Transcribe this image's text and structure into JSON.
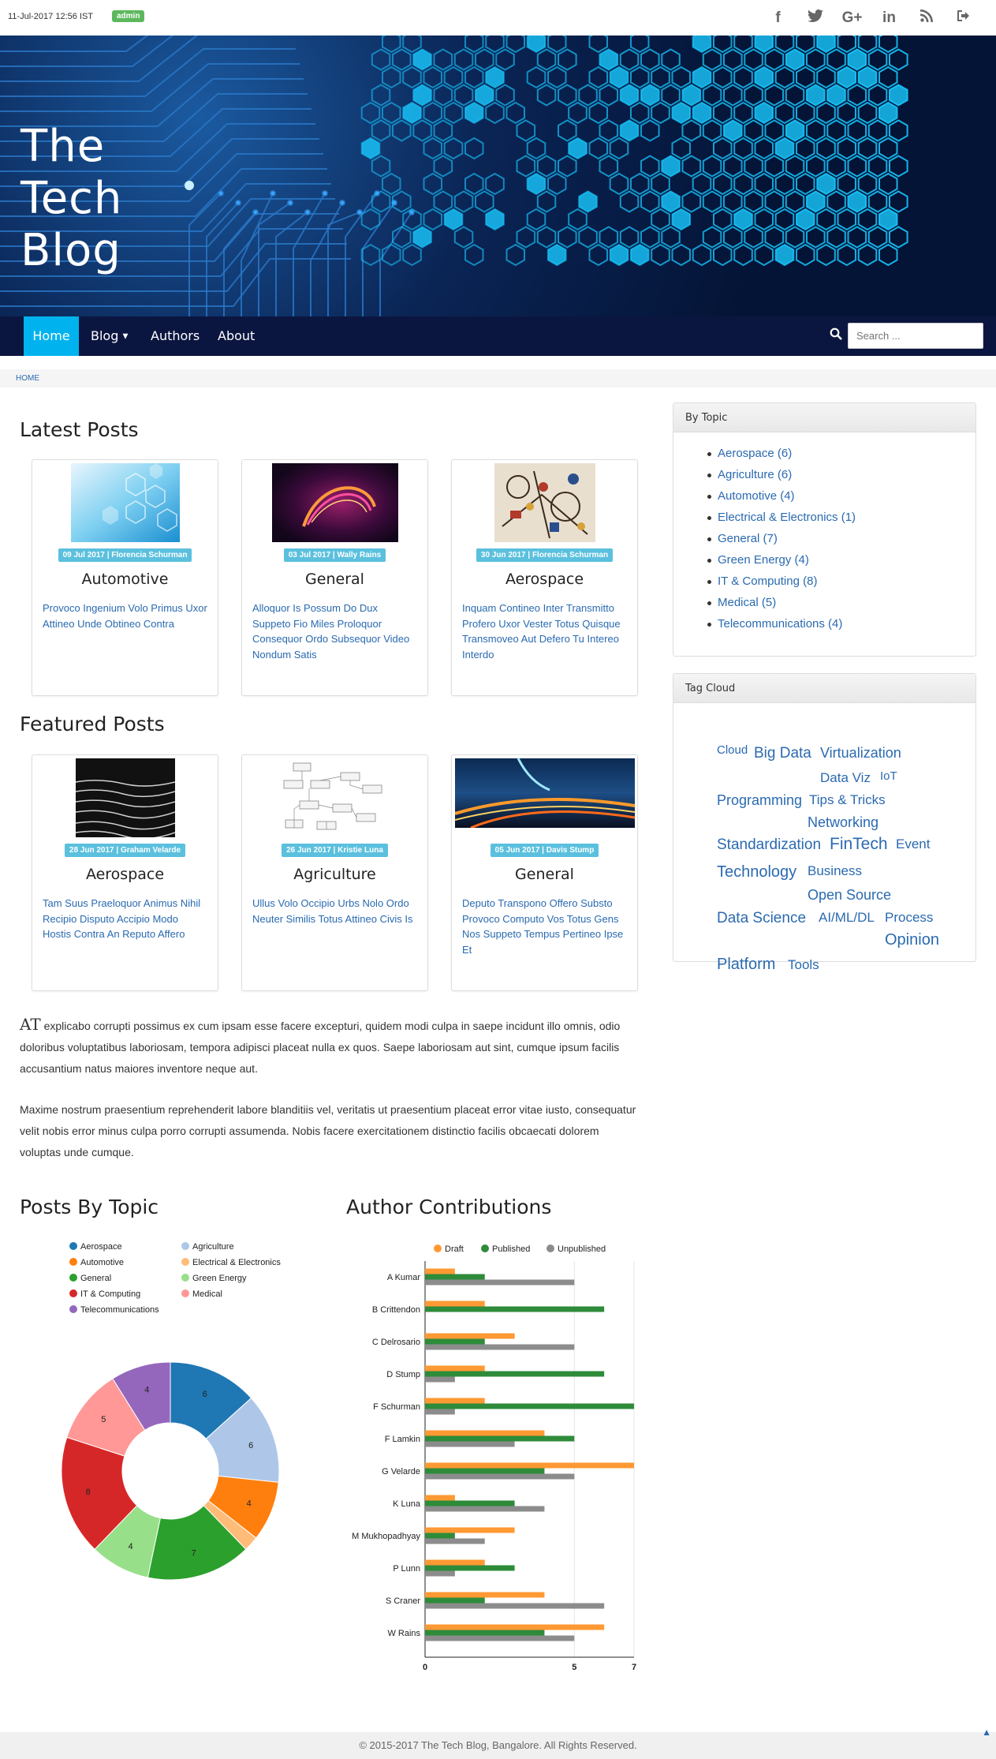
{
  "topbar": {
    "datetime": "11-Jul-2017 12:56 IST",
    "user_badge": "admin",
    "social_icons": [
      "facebook-icon",
      "twitter-icon",
      "google-plus-icon",
      "linkedin-icon",
      "rss-icon",
      "sign-out-icon"
    ]
  },
  "hero": {
    "title_lines": [
      "The",
      "Tech",
      "Blog"
    ]
  },
  "nav": {
    "items": [
      "Home",
      "Blog",
      "Authors",
      "About"
    ],
    "search_placeholder": "Search ..."
  },
  "breadcrumb": "HOME",
  "latest": {
    "heading": "Latest Posts",
    "posts": [
      {
        "meta": "09 Jul 2017 | Florencia Schurman",
        "category": "Automotive",
        "title": "Provoco Ingenium Volo Primus Uxor Attineo Unde Obtineo Contra"
      },
      {
        "meta": "03 Jul 2017 | Wally Rains",
        "category": "General",
        "title": "Alloquor Is Possum Do Dux Suppeto Fio Miles Proloquor Consequor Ordo Subsequor Video Nondum Satis"
      },
      {
        "meta": "30 Jun 2017 | Florencia Schurman",
        "category": "Aerospace",
        "title": "Inquam Contineo Inter Transmitto Profero Uxor Vester Totus Quisque Transmoveo Aut Defero Tu Intereo Interdo"
      }
    ]
  },
  "featured": {
    "heading": "Featured Posts",
    "posts": [
      {
        "meta": "28 Jun 2017 | Graham Velarde",
        "category": "Aerospace",
        "title": "Tam Suus Praeloquor Animus Nihil Recipio Disputo Accipio Modo Hostis Contra An Reputo Affero"
      },
      {
        "meta": "26 Jun 2017 | Kristie Luna",
        "category": "Agriculture",
        "title": "Ullus Volo Occipio Urbs Nolo Ordo Neuter Similis Totus Attineo Civis Is"
      },
      {
        "meta": "05 Jun 2017 | Davis Stump",
        "category": "General",
        "title": "Deputo Transpono Offero Substo Provoco Computo Vos Totus Gens Nos Suppeto Tempus Pertineo Ipse Et"
      }
    ]
  },
  "body": {
    "dropcap": "AT",
    "para1": "explicabo corrupti possimus ex cum ipsam esse facere excepturi, quidem modi culpa in saepe incidunt illo omnis, odio doloribus voluptatibus laboriosam, tempora adipisci placeat nulla ex quos. Saepe laboriosam aut sint, cumque ipsum facilis accusantium natus maiores inventore neque aut.",
    "para2": "Maxime nostrum praesentium reprehenderit labore blanditiis vel, veritatis ut praesentium placeat error vitae iusto, consequatur velit nobis error minus culpa porro corrupti assumenda. Nobis facere exercitationem distinctio facilis obcaecati dolorem voluptas unde cumque."
  },
  "sidebar": {
    "topics_heading": "By Topic",
    "topics": [
      "Aerospace (6)",
      "Agriculture (6)",
      "Automotive (4)",
      "Electrical & Electronics (1)",
      "General (7)",
      "Green Energy (4)",
      "IT & Computing (8)",
      "Medical (5)",
      "Telecommunications (4)"
    ],
    "tags_heading": "Tag Cloud",
    "tags": [
      "Cloud",
      "Big Data",
      "Virtualization",
      "Data Viz",
      "IoT",
      "Programming",
      "Tips & Tricks",
      "Networking",
      "Standardization",
      "FinTech",
      "Event",
      "Technology",
      "Business",
      "Open Source",
      "Data Science",
      "AI/ML/DL",
      "Process",
      "Opinion",
      "Platform",
      "Tools"
    ]
  },
  "charts": {
    "topic_heading": "Posts By Topic",
    "author_heading": "Author Contributions"
  },
  "chart_data": [
    {
      "type": "pie",
      "categories": [
        "Aerospace",
        "Agriculture",
        "Automotive",
        "Electrical & Electronics",
        "General",
        "Green Energy",
        "IT & Computing",
        "Medical",
        "Telecommunications"
      ],
      "values": [
        6,
        6,
        4,
        1,
        7,
        4,
        8,
        5,
        4
      ],
      "colors": [
        "#1f77b4",
        "#aec7e8",
        "#ff7f0e",
        "#ffbb78",
        "#2ca02c",
        "#98df8a",
        "#d62728",
        "#ff9896",
        "#9467bd"
      ],
      "legend": "top"
    },
    {
      "type": "bar",
      "orientation": "horizontal",
      "categories": [
        "A Kumar",
        "B Crittendon",
        "C Delrosario",
        "D Stump",
        "F Schurman",
        "F Lamkin",
        "G Velarde",
        "K Luna",
        "M Mukhopadhyay",
        "P Lunn",
        "S Craner",
        "W Rains"
      ],
      "series": [
        {
          "name": "Draft",
          "color": "#ff9933",
          "values": [
            1,
            2,
            3,
            2,
            2,
            4,
            7,
            1,
            3,
            2,
            4,
            6
          ]
        },
        {
          "name": "Published",
          "color": "#2e8b3a",
          "values": [
            2,
            6,
            2,
            6,
            7,
            5,
            4,
            3,
            1,
            3,
            2,
            4
          ]
        },
        {
          "name": "Unpublished",
          "color": "#8c8c8c",
          "values": [
            5,
            0,
            5,
            1,
            1,
            3,
            5,
            4,
            2,
            1,
            6,
            5
          ]
        }
      ],
      "xticks": [
        0,
        5,
        7
      ],
      "xlim": [
        0,
        7
      ],
      "legend": "top"
    }
  ],
  "footer": "© 2015-2017 The Tech Blog, Bangalore. All Rights Reserved."
}
